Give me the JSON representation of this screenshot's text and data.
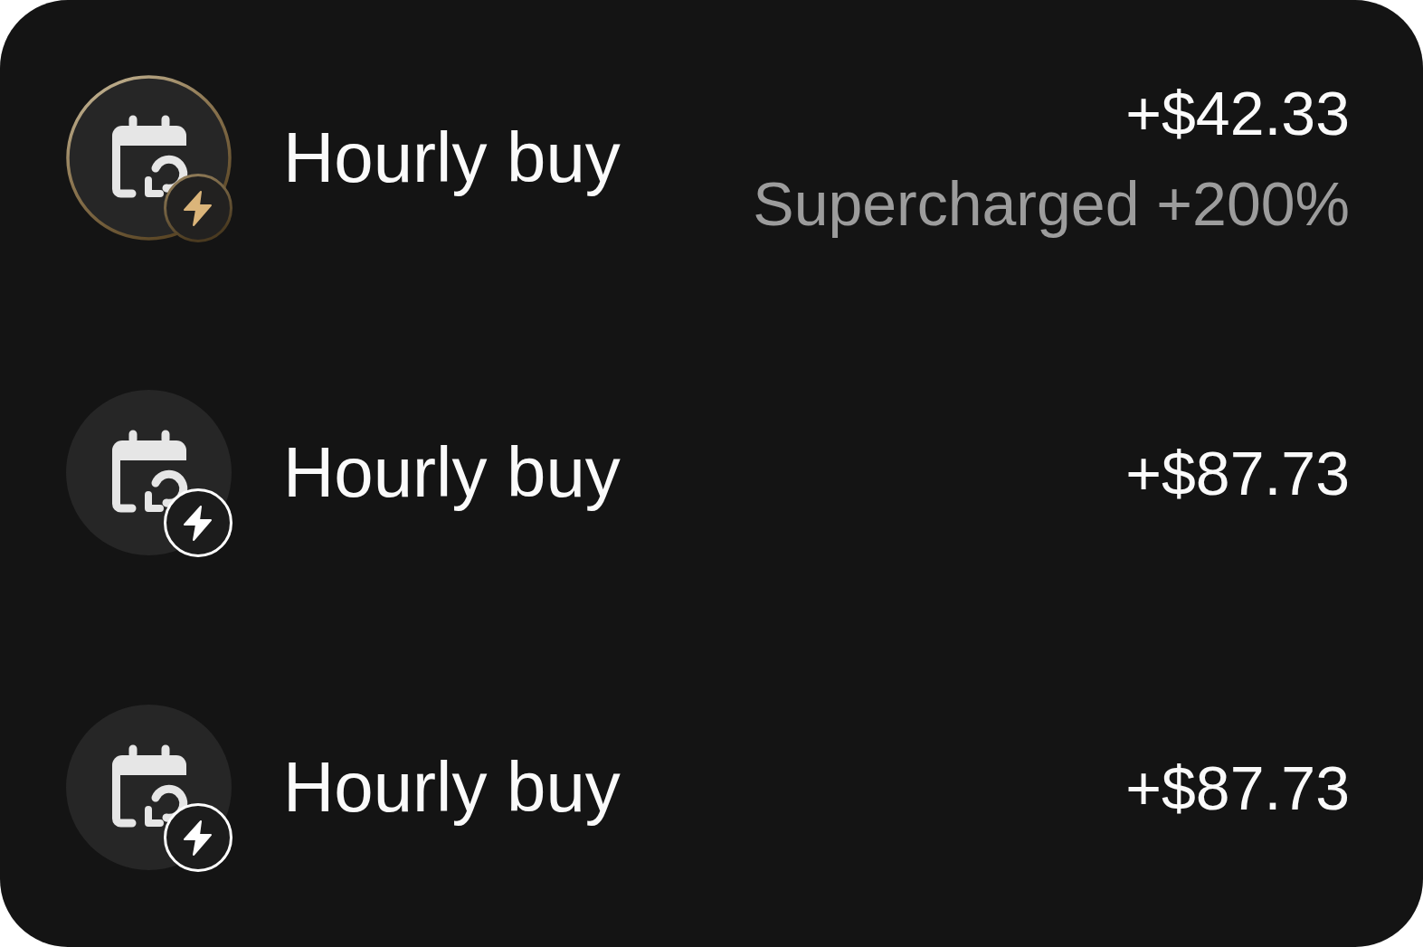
{
  "rows": [
    {
      "title": "Hourly buy",
      "amount": "+$42.33",
      "note": "Supercharged +200%",
      "supercharged": true
    },
    {
      "title": "Hourly buy",
      "amount": "+$87.73",
      "supercharged": false
    },
    {
      "title": "Hourly buy",
      "amount": "+$87.73",
      "supercharged": false
    }
  ]
}
